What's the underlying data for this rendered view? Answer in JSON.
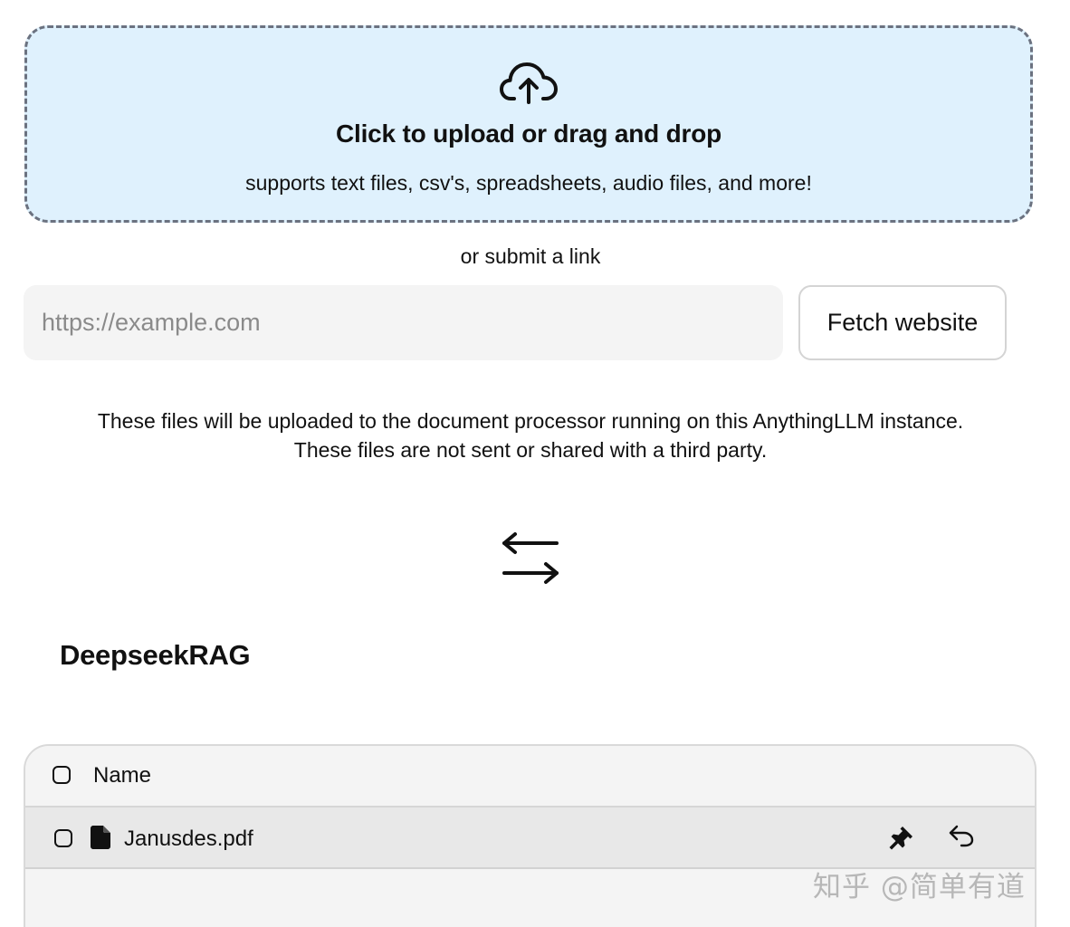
{
  "upload": {
    "title": "Click to upload or drag and drop",
    "subtitle": "supports text files, csv's, spreadsheets, audio files, and more!",
    "icon": "cloud-upload-icon"
  },
  "link": {
    "label": "or submit a link",
    "placeholder": "https://example.com",
    "value": "",
    "button_label": "Fetch website"
  },
  "notice": {
    "line1": "These files will be uploaded to the document processor running on this AnythingLLM instance.",
    "line2": "These files are not sent or shared with a third party."
  },
  "icons": {
    "swap": "arrows-swap-icon",
    "file": "file-icon",
    "pin": "pin-icon",
    "undo": "undo-icon"
  },
  "workspace": {
    "title": "DeepseekRAG",
    "table": {
      "header": "Name",
      "rows": [
        {
          "name": "Janusdes.pdf"
        }
      ]
    }
  },
  "watermark": "知乎 @简单有道",
  "colors": {
    "dropzone_bg": "#dff1fd",
    "dropzone_border": "#6b7280",
    "input_bg": "#f4f4f4",
    "row_bg": "#e8e8e8",
    "text": "#111111"
  }
}
